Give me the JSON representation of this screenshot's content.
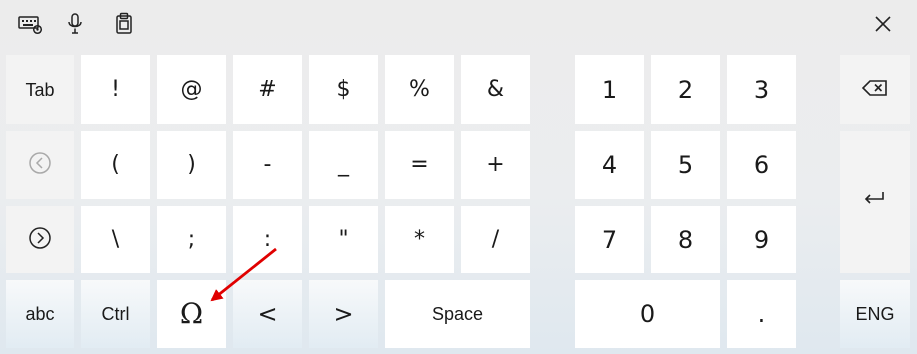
{
  "topbar": {
    "icons": [
      {
        "name": "keyboard-settings-icon"
      },
      {
        "name": "microphone-icon"
      },
      {
        "name": "clipboard-icon"
      }
    ],
    "close_icon": "close-icon"
  },
  "keyboard": {
    "row1": {
      "tab": "Tab",
      "symbols": [
        "!",
        "@",
        "#",
        "$",
        "%",
        "&"
      ],
      "numpad": [
        "1",
        "2",
        "3"
      ]
    },
    "row2": {
      "back_icon": "circle-left-icon",
      "symbols": [
        "(",
        ")",
        "-",
        "_",
        "=",
        "+"
      ],
      "numpad": [
        "4",
        "5",
        "6"
      ]
    },
    "row3": {
      "forward_icon": "circle-right-icon",
      "symbols": [
        "\\",
        ";",
        ":",
        "\"",
        "*",
        "/"
      ],
      "numpad": [
        "7",
        "8",
        "9"
      ]
    },
    "row4": {
      "abc": "abc",
      "ctrl": "Ctrl",
      "omega": "Ω",
      "left": "<",
      "right": ">",
      "space": "Space",
      "zero": "0",
      "dot": ".",
      "lang": "ENG"
    },
    "right_column": {
      "backspace_icon": "backspace-icon",
      "enter_icon": "enter-icon"
    }
  },
  "annotation": {
    "arrow_color": "#e00000"
  }
}
